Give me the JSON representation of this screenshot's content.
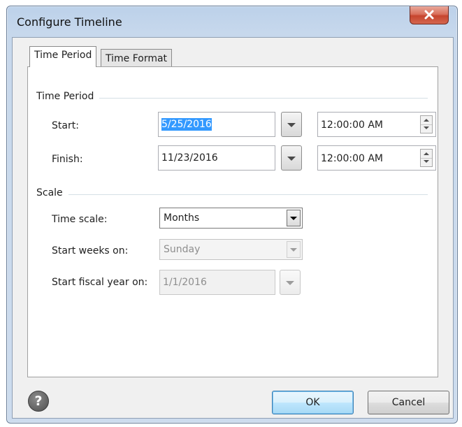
{
  "window": {
    "title": "Configure Timeline"
  },
  "tabs": [
    {
      "label": "Time Period",
      "active": true
    },
    {
      "label": "Time Format",
      "active": false
    }
  ],
  "time_period": {
    "group_label": "Time Period",
    "start": {
      "label": "Start:",
      "date": "5/25/2016",
      "time": "12:00:00 AM"
    },
    "finish": {
      "label": "Finish:",
      "date": "11/23/2016",
      "time": "12:00:00 AM"
    }
  },
  "scale": {
    "group_label": "Scale",
    "time_scale": {
      "label": "Time scale:",
      "value": "Months"
    },
    "start_weeks": {
      "label": "Start weeks on:",
      "value": "Sunday",
      "enabled": false
    },
    "fiscal_year": {
      "label": "Start fiscal year on:",
      "value": "1/1/2016",
      "enabled": false
    }
  },
  "footer": {
    "help_symbol": "?",
    "ok_label": "OK",
    "cancel_label": "Cancel"
  },
  "colors": {
    "selection": "#3399ff",
    "close_button": "#c6452e",
    "title_bar": "#bcd1ea"
  }
}
